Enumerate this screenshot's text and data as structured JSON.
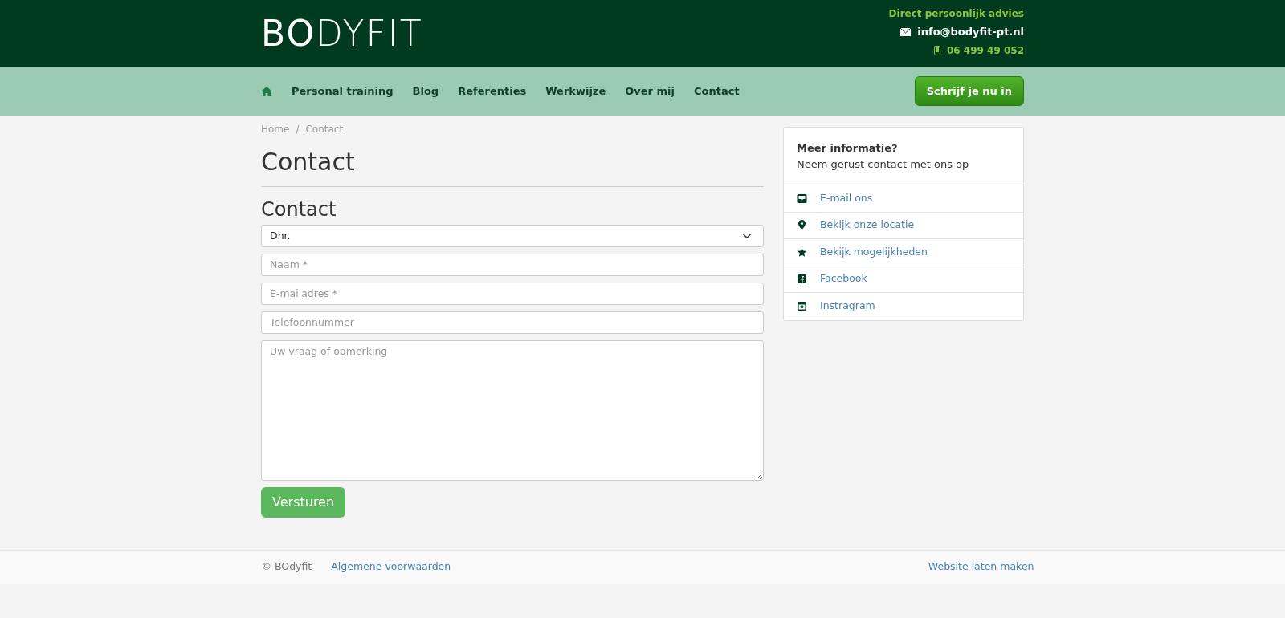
{
  "header": {
    "logo": "**BO**DYFIT",
    "tagline": "Direct persoonlijk advies",
    "email": "info@bodyfit-pt.nl",
    "phone": "06 499 49 052"
  },
  "nav": {
    "items": [
      {
        "label": "Personal training"
      },
      {
        "label": "Blog"
      },
      {
        "label": "Referenties"
      },
      {
        "label": "Werkwijze"
      },
      {
        "label": "Over mij"
      },
      {
        "label": "Contact"
      }
    ],
    "cta": "Schrijf je nu in"
  },
  "breadcrumb": {
    "items": [
      "Home",
      "Contact"
    ],
    "separator": "/"
  },
  "page_title": "Contact",
  "form": {
    "title": "Contact",
    "salutation": "Dhr.",
    "fields": [
      {
        "placeholder": "Naam *",
        "kind": "input"
      },
      {
        "placeholder": "E-mailadres *",
        "kind": "input"
      },
      {
        "placeholder": "Telefoonnummer",
        "kind": "input"
      },
      {
        "placeholder": "Uw vraag of opmerking",
        "kind": "textarea"
      }
    ],
    "submit": "Versturen"
  },
  "sidebar": {
    "title": "Meer informatie?",
    "subtitle": "Neem gerust contact met ons op",
    "links": [
      {
        "label": "E-mail ons",
        "kind": "inbox"
      },
      {
        "label": "Bekijk onze locatie",
        "kind": "pin"
      },
      {
        "label": "Bekijk mogelijkheden",
        "kind": "star"
      },
      {
        "label": "Facebook",
        "kind": "facebook"
      },
      {
        "label": "Instragram",
        "kind": "instagram"
      }
    ]
  },
  "footer": {
    "copyright": "© BOdyfit",
    "terms": "Algemene voorwaarden",
    "credit": "Website laten maken"
  }
}
